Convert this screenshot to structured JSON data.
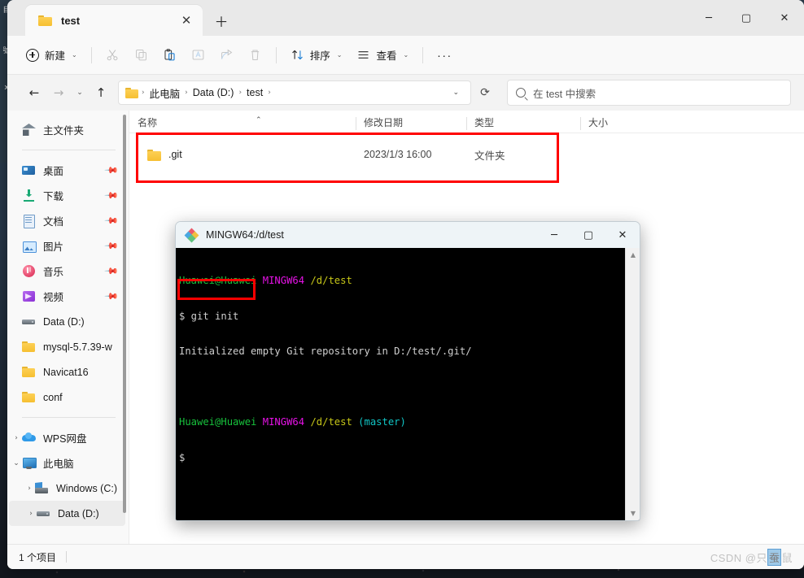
{
  "window": {
    "tab_title": "test",
    "tab_close_icon": "close-icon",
    "new_tab_icon": "plus-icon",
    "minimize_icon": "minimize-icon",
    "maximize_icon": "maximize-icon",
    "close_icon": "close-icon"
  },
  "toolbar": {
    "new_label": "新建",
    "cut_icon": "scissors-icon",
    "copy_icon": "copy-icon",
    "paste_icon": "paste-icon",
    "rename_icon": "rename-icon",
    "share_icon": "share-icon",
    "delete_icon": "trash-icon",
    "sort_label": "排序",
    "sort_icon": "sort-arrows-icon",
    "view_label": "查看",
    "view_icon": "list-lines-icon",
    "more_label": "···"
  },
  "address": {
    "back_icon": "arrow-left-icon",
    "forward_icon": "arrow-right-icon",
    "recent_icon": "chevron-down-icon",
    "up_icon": "arrow-up-icon",
    "crumbs": [
      "此电脑",
      "Data (D:)",
      "test"
    ],
    "separator": "›",
    "dropdown_icon": "chevron-down-icon",
    "refresh_icon": "refresh-icon"
  },
  "search": {
    "placeholder": "在 test 中搜索",
    "icon": "search-icon"
  },
  "sidebar": {
    "items": [
      {
        "label": "主文件夹",
        "icon": "home-icon",
        "kind": "root",
        "pin": false,
        "expander": ""
      },
      {
        "label": "桌面",
        "icon": "desktop-icon",
        "kind": "quick",
        "pin": true,
        "expander": ""
      },
      {
        "label": "下载",
        "icon": "download-icon",
        "kind": "quick",
        "pin": true,
        "expander": ""
      },
      {
        "label": "文档",
        "icon": "document-icon",
        "kind": "quick",
        "pin": true,
        "expander": ""
      },
      {
        "label": "图片",
        "icon": "pictures-icon",
        "kind": "quick",
        "pin": true,
        "expander": ""
      },
      {
        "label": "音乐",
        "icon": "music-icon",
        "kind": "quick",
        "pin": true,
        "expander": ""
      },
      {
        "label": "视频",
        "icon": "video-icon",
        "kind": "quick",
        "pin": true,
        "expander": ""
      },
      {
        "label": "Data (D:)",
        "icon": "drive-icon",
        "kind": "quick",
        "pin": false,
        "expander": ""
      },
      {
        "label": "mysql-5.7.39-w",
        "icon": "folder-icon",
        "kind": "quick",
        "pin": false,
        "expander": ""
      },
      {
        "label": "Navicat16",
        "icon": "folder-icon",
        "kind": "quick",
        "pin": false,
        "expander": ""
      },
      {
        "label": "conf",
        "icon": "folder-icon",
        "kind": "quick",
        "pin": false,
        "expander": ""
      },
      {
        "label": "WPS网盘",
        "icon": "cloud-icon",
        "kind": "tree",
        "pin": false,
        "expander": "›"
      },
      {
        "label": "此电脑",
        "icon": "pc-icon",
        "kind": "tree",
        "pin": false,
        "expander": "⌄"
      },
      {
        "label": "Windows (C:)",
        "icon": "windows-drive-icon",
        "kind": "child",
        "pin": false,
        "expander": "›"
      },
      {
        "label": "Data (D:)",
        "icon": "drive-icon",
        "kind": "child",
        "pin": false,
        "expander": "›"
      }
    ]
  },
  "filelist": {
    "columns": [
      {
        "key": "name",
        "label": "名称"
      },
      {
        "key": "date",
        "label": "修改日期"
      },
      {
        "key": "type",
        "label": "类型"
      },
      {
        "key": "size",
        "label": "大小"
      }
    ],
    "sort_caret": "⌃",
    "rows": [
      {
        "name": ".git",
        "date": "2023/1/3 16:00",
        "type": "文件夹",
        "size": "",
        "icon": "folder-icon"
      }
    ]
  },
  "status": {
    "count_text": "1 个项目",
    "watermark_prefix": "CSDN @只",
    "watermark_highlight": "蚕",
    "watermark_suffix": "鼠"
  },
  "terminal": {
    "title": "MINGW64:/d/test",
    "logo_icon": "mingw-diamond-icon",
    "minimize_icon": "minimize-icon",
    "maximize_icon": "maximize-icon",
    "close_icon": "close-icon",
    "scroll_up_icon": "triangle-up-icon",
    "scroll_down_icon": "triangle-down-icon",
    "lines": [
      {
        "segments": [
          {
            "text": "Huawei@Huawei ",
            "color": "green"
          },
          {
            "text": "MINGW64 ",
            "color": "magenta"
          },
          {
            "text": "/d/test",
            "color": "yellow"
          }
        ]
      },
      {
        "segments": [
          {
            "text": "$ git init",
            "color": "white"
          }
        ]
      },
      {
        "segments": [
          {
            "text": "Initialized empty Git repository in D:/test/.git/",
            "color": "white"
          }
        ]
      },
      {
        "segments": [
          {
            "text": "",
            "color": "white"
          }
        ]
      },
      {
        "segments": [
          {
            "text": "Huawei@Huawei ",
            "color": "green"
          },
          {
            "text": "MINGW64 ",
            "color": "magenta"
          },
          {
            "text": "/d/test ",
            "color": "yellow"
          },
          {
            "text": "(master)",
            "color": "cyan"
          }
        ]
      },
      {
        "segments": [
          {
            "text": "$",
            "color": "white"
          }
        ]
      }
    ]
  },
  "annotations": [
    {
      "name": "red-box-file-row",
      "color": "#ff0000"
    },
    {
      "name": "red-box-git-init-command",
      "color": "#ff0000"
    }
  ],
  "desktop_icons": [
    "目",
    "號",
    "x"
  ]
}
